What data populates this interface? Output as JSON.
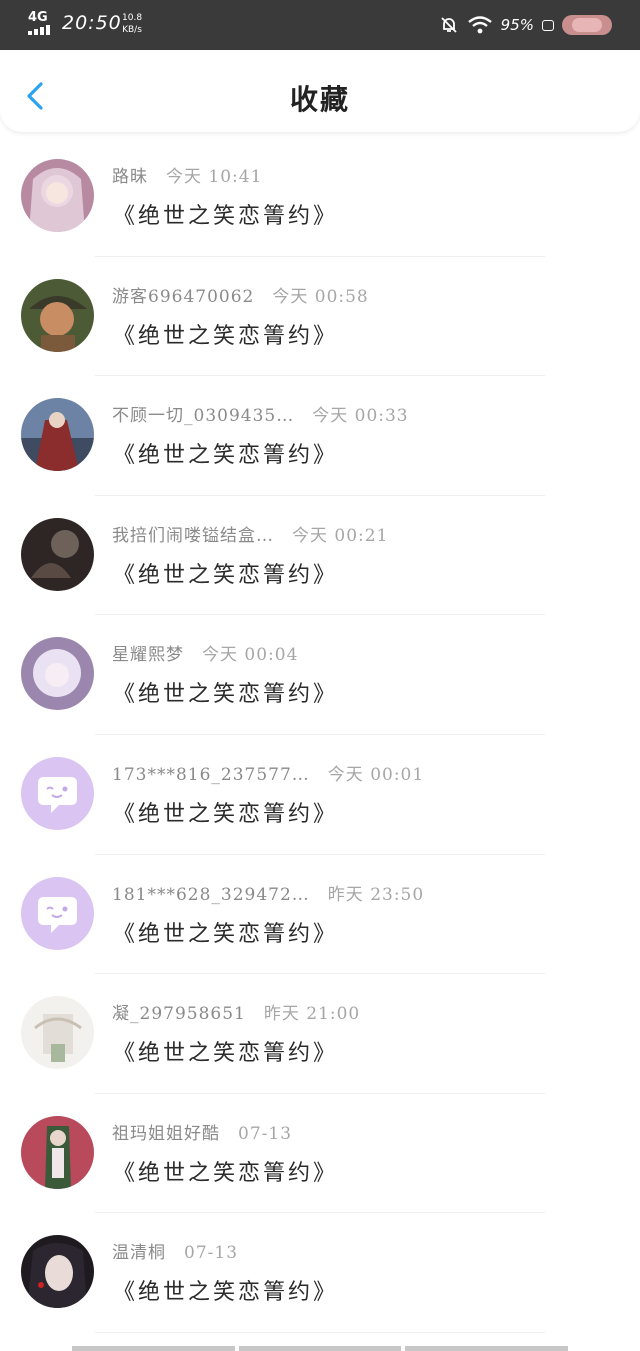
{
  "status_bar": {
    "network": "4G",
    "time": "20:50",
    "speed_value": "10.8",
    "speed_unit": "KB/s",
    "battery_percent": "95%"
  },
  "header": {
    "title": "收藏"
  },
  "colors": {
    "accent": "#2aa3f0",
    "default_avatar_bg": "#d9c4f2"
  },
  "list": {
    "items": [
      {
        "name": "路昧",
        "time": "今天 10:41",
        "message": "《绝世之笑恋箐约》",
        "avatar": "photo-avatar"
      },
      {
        "name": "游客696470062",
        "time": "今天 00:58",
        "message": "《绝世之笑恋箐约》",
        "avatar": "photo-avatar"
      },
      {
        "name": "不顾一切_0309435…",
        "time": "今天 00:33",
        "message": "《绝世之笑恋箐约》",
        "avatar": "photo-avatar"
      },
      {
        "name": "我掊们闹喽镒结盒…",
        "time": "今天 00:21",
        "message": "《绝世之笑恋箐约》",
        "avatar": "photo-avatar"
      },
      {
        "name": "星耀熙梦",
        "time": "今天 00:04",
        "message": "《绝世之笑恋箐约》",
        "avatar": "photo-avatar"
      },
      {
        "name": "173***816_237577…",
        "time": "今天 00:01",
        "message": "《绝世之笑恋箐约》",
        "avatar": "chat-bubble-default-avatar"
      },
      {
        "name": "181***628_329472…",
        "time": "昨天 23:50",
        "message": "《绝世之笑恋箐约》",
        "avatar": "chat-bubble-default-avatar"
      },
      {
        "name": "凝_297958651",
        "time": "昨天 21:00",
        "message": "《绝世之笑恋箐约》",
        "avatar": "photo-avatar"
      },
      {
        "name": "祖玛姐姐好酷",
        "time": "07-13",
        "message": "《绝世之笑恋箐约》",
        "avatar": "photo-avatar"
      },
      {
        "name": "温清桐",
        "time": "07-13",
        "message": "《绝世之笑恋箐约》",
        "avatar": "photo-avatar"
      }
    ]
  }
}
